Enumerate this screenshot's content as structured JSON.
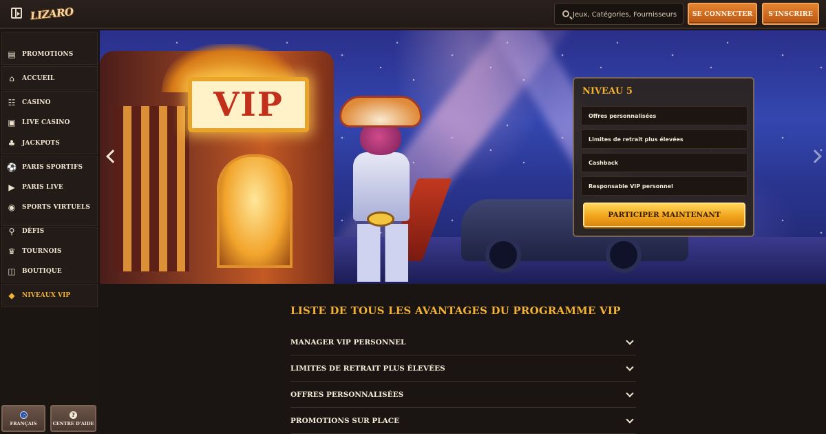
{
  "header": {
    "logo_text": "LIZARO",
    "search_placeholder": "Jeux, Catégories, Fournisseurs",
    "login_label": "SE CONNECTER",
    "register_label": "S'INSCRIRE"
  },
  "sidebar": {
    "items": [
      {
        "label": "PROMOTIONS",
        "icon": "gift-icon"
      },
      {
        "label": "ACCUEIL",
        "icon": "home-icon"
      },
      {
        "label": "CASINO",
        "icon": "casino-icon"
      },
      {
        "label": "LIVE CASINO",
        "icon": "live-casino-icon"
      },
      {
        "label": "JACKPOTS",
        "icon": "clover-icon"
      },
      {
        "label": "PARIS SPORTIFS",
        "icon": "sports-ball-icon"
      },
      {
        "label": "PARIS LIVE",
        "icon": "play-icon"
      },
      {
        "label": "SPORTS VIRTUELS",
        "icon": "virtual-sports-icon"
      },
      {
        "label": "DÉFIS",
        "icon": "medal-icon"
      },
      {
        "label": "TOURNOIS",
        "icon": "trophy-icon"
      },
      {
        "label": "BOUTIQUE",
        "icon": "shop-icon"
      },
      {
        "label": "NIVEAUX VIP",
        "icon": "diamond-icon",
        "active": true
      }
    ],
    "footer": {
      "language_label": "FRANÇAIS",
      "help_label": "CENTRE D'AIDE"
    }
  },
  "hero": {
    "sign_text": "VIP",
    "panel": {
      "level": "NIVEAU 5",
      "benefits": [
        "Offres personnalisées",
        "Limites de retrait plus élevées",
        "Cashback",
        "Responsable VIP personnel"
      ],
      "cta_label": "PARTICIPER MAINTENANT"
    }
  },
  "main": {
    "title": "LISTE DE TOUS LES AVANTAGES DU PROGRAMME VIP",
    "accordion": [
      "MANAGER VIP PERSONNEL",
      "LIMITES DE RETRAIT PLUS ÉLEVÉES",
      "OFFRES PERSONNALISÉES",
      "PROMOTIONS SUR PLACE"
    ]
  },
  "colors": {
    "accent_gold": "#f2b233",
    "button_orange": "#e4832f",
    "background": "#1b1512"
  }
}
